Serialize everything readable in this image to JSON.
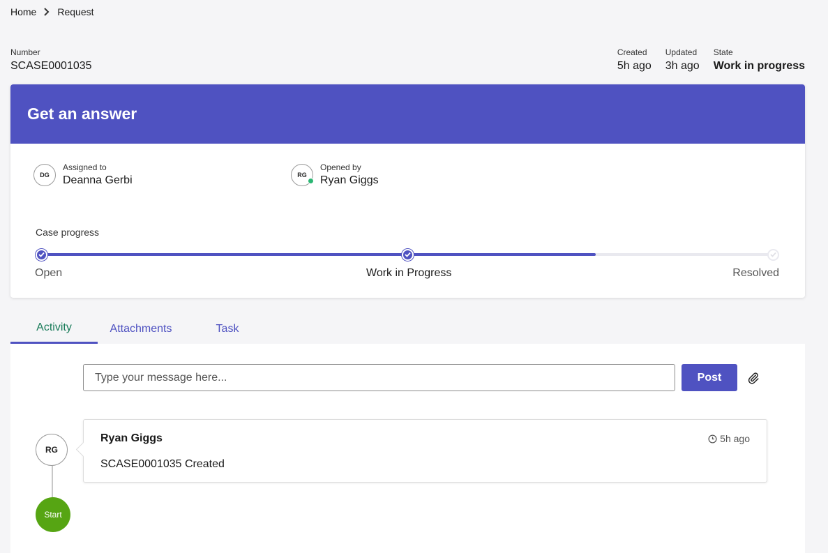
{
  "breadcrumb": {
    "home": "Home",
    "current": "Request"
  },
  "case": {
    "number_label": "Number",
    "number": "SCASE0001035",
    "created_label": "Created",
    "created": "5h ago",
    "updated_label": "Updated",
    "updated": "3h ago",
    "state_label": "State",
    "state": "Work in progress"
  },
  "card": {
    "title": "Get an answer",
    "assigned": {
      "label": "Assigned to",
      "name": "Deanna Gerbi",
      "initials": "DG"
    },
    "opened": {
      "label": "Opened by",
      "name": "Ryan Giggs",
      "initials": "RG"
    },
    "progress": {
      "title": "Case progress",
      "steps": [
        {
          "label": "Open",
          "status": "done"
        },
        {
          "label": "Work in Progress",
          "status": "done"
        },
        {
          "label": "Resolved",
          "status": "todo"
        }
      ],
      "fill_fraction": 0.76
    }
  },
  "tabs": [
    {
      "label": "Activity",
      "active": true
    },
    {
      "label": "Attachments",
      "active": false
    },
    {
      "label": "Task",
      "active": false
    }
  ],
  "activity": {
    "input_placeholder": "Type your message here...",
    "post_label": "Post",
    "entries": [
      {
        "initials": "RG",
        "author": "Ryan Giggs",
        "time": "5h ago",
        "text": "SCASE0001035 Created"
      }
    ],
    "start_label": "Start"
  },
  "colors": {
    "accent": "#4f52c1",
    "active_tab_text": "#1a7c5a",
    "start": "#56a513",
    "online": "#2bb673"
  }
}
